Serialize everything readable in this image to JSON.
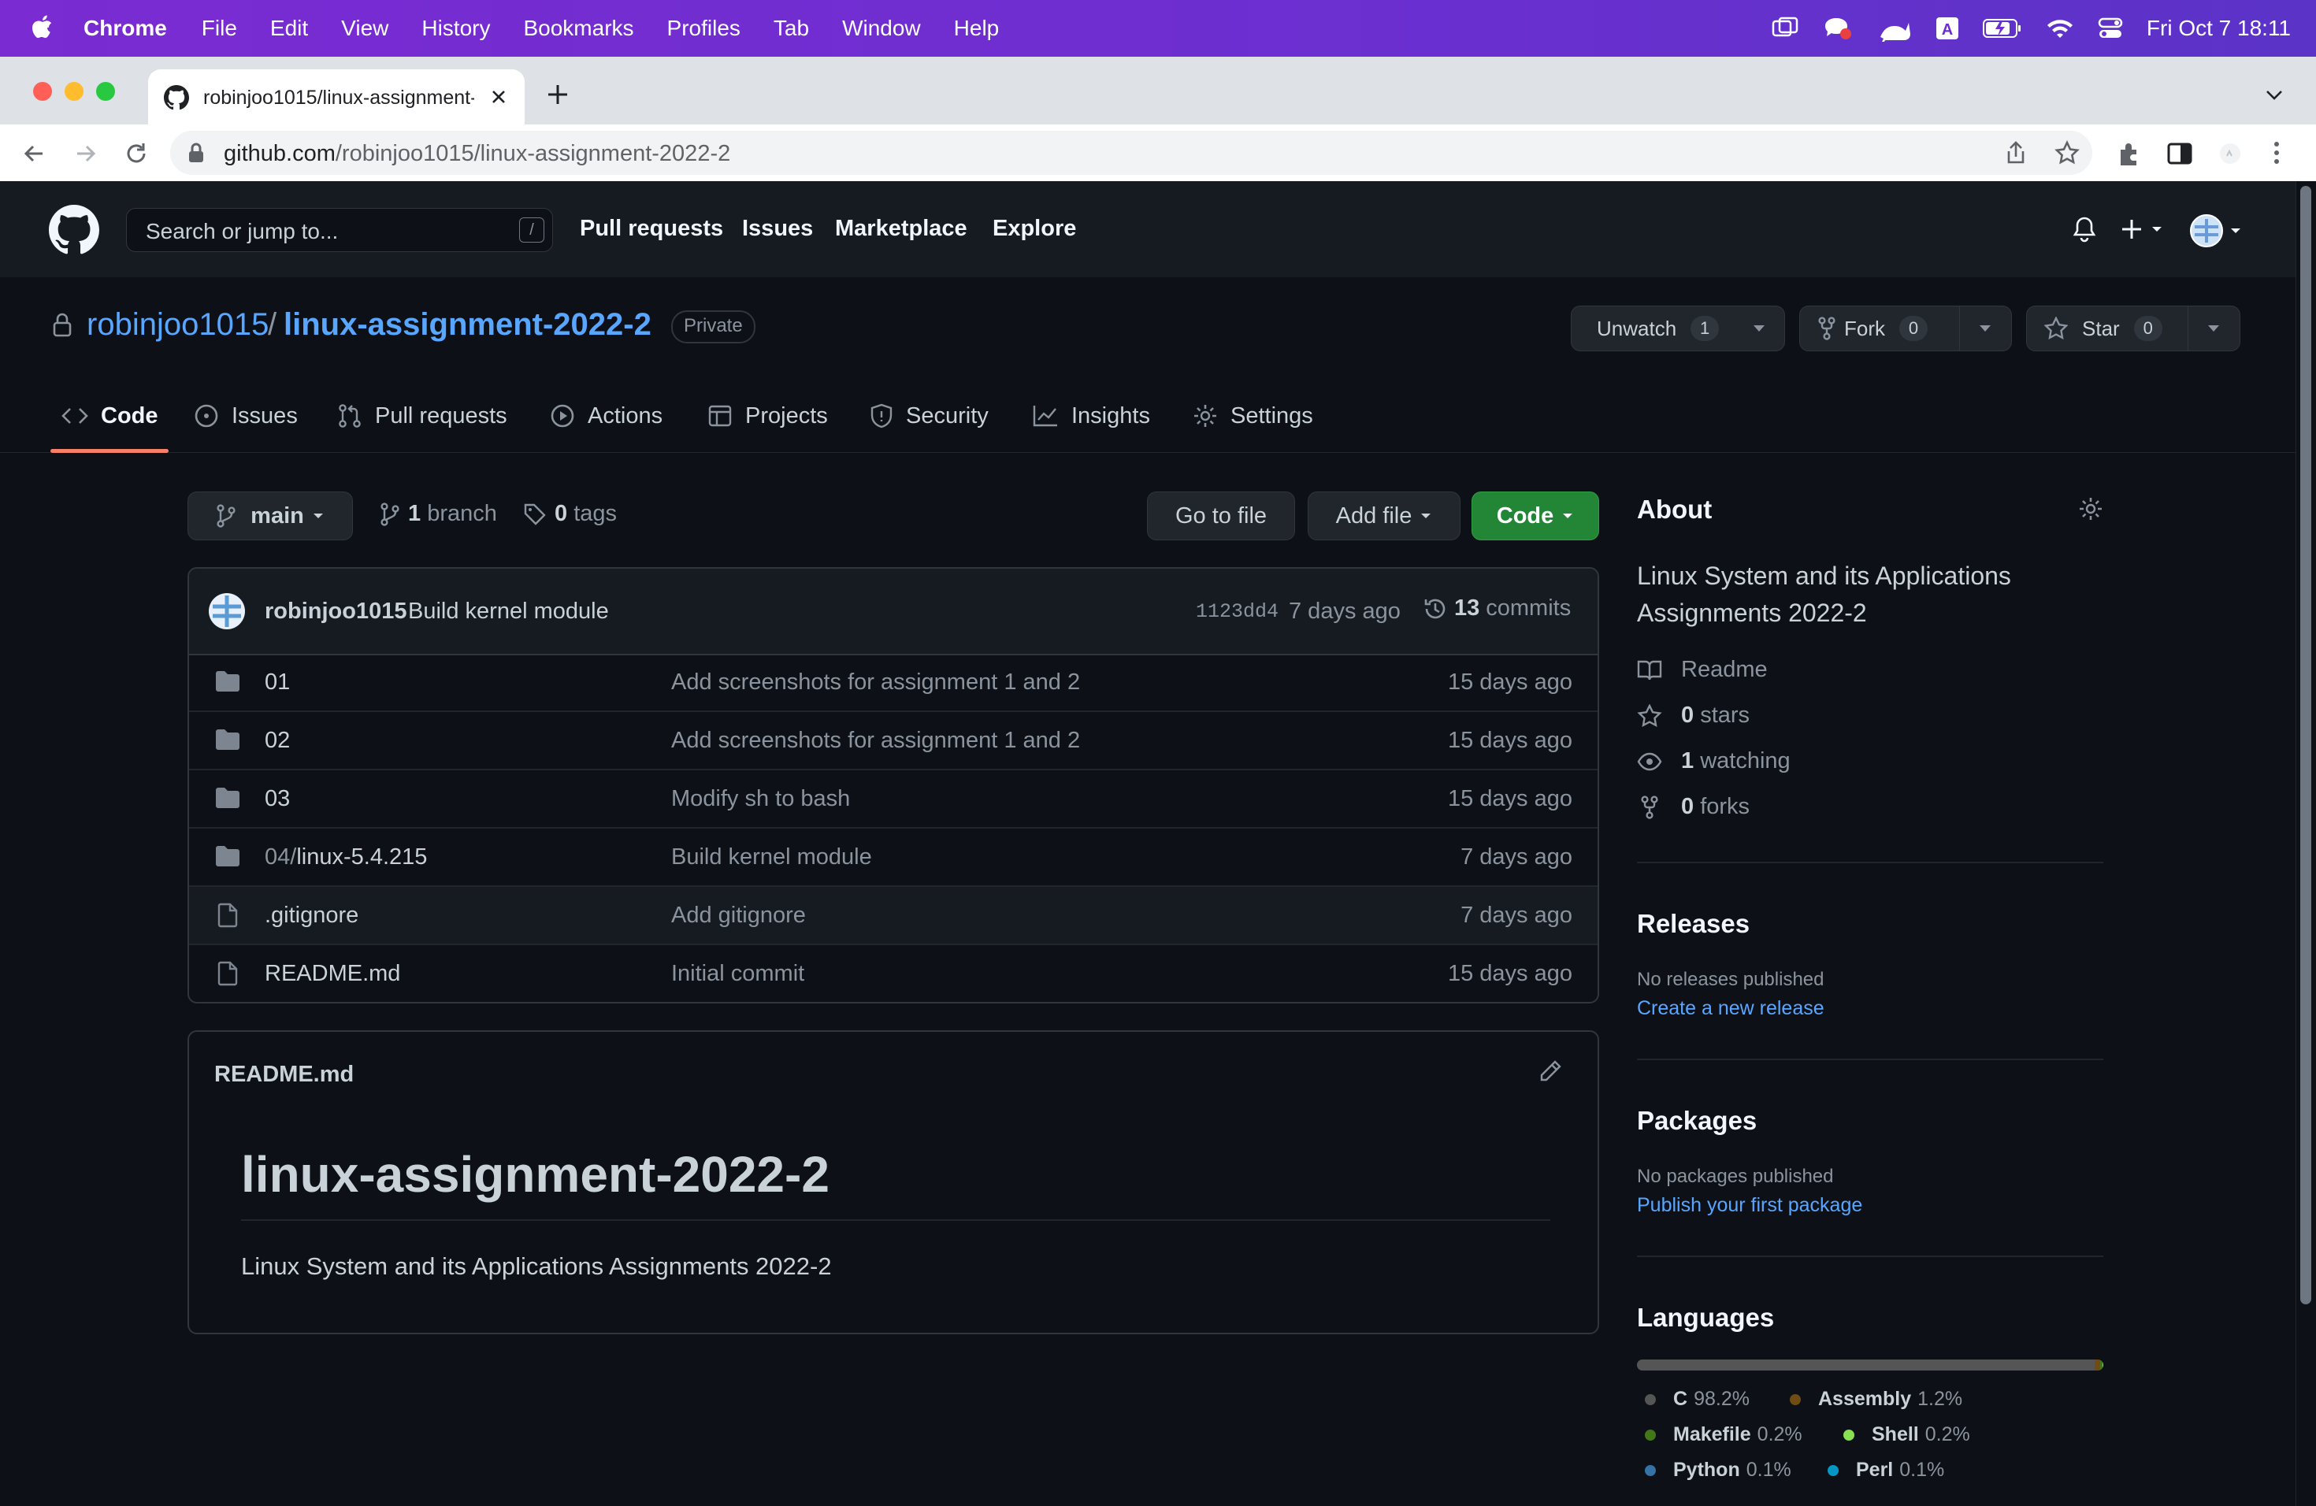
{
  "menubar": {
    "app_name": "Chrome",
    "menus": [
      "File",
      "Edit",
      "View",
      "History",
      "Bookmarks",
      "Profiles",
      "Tab",
      "Window",
      "Help"
    ],
    "clock": "Fri Oct 7  18:11"
  },
  "browser": {
    "tab_title": "robinjoo1015/linux-assignment-2022-2",
    "url_host": "github.com",
    "url_path": "/robinjoo1015/linux-assignment-2022-2"
  },
  "github": {
    "search_placeholder": "Search or jump to...",
    "search_shortcut": "/",
    "nav": [
      "Pull requests",
      "Issues",
      "Marketplace",
      "Explore"
    ]
  },
  "repo": {
    "owner": "robinjoo1015",
    "separator": "/",
    "name": "linux-assignment-2022-2",
    "visibility": "Private",
    "unwatch_label": "Unwatch",
    "watch_count": "1",
    "fork_label": "Fork",
    "fork_count": "0",
    "star_label": "Star",
    "star_count": "0",
    "tabs": [
      "Code",
      "Issues",
      "Pull requests",
      "Actions",
      "Projects",
      "Security",
      "Insights",
      "Settings"
    ]
  },
  "branchbar": {
    "branch": "main",
    "branch_count": "1",
    "branch_label": "branch",
    "tag_count": "0",
    "tag_label": "tags",
    "go_to_file": "Go to file",
    "add_file": "Add file",
    "code": "Code"
  },
  "latest_commit": {
    "author": "robinjoo1015",
    "message": "Build kernel module",
    "sha": "1123dd4",
    "age": "7 days ago",
    "commit_count": "13",
    "commit_label": "commits"
  },
  "files": [
    {
      "prefix": "",
      "name": "01",
      "type": "dir",
      "message": "Add screenshots for assignment 1 and 2",
      "age": "15 days ago"
    },
    {
      "prefix": "",
      "name": "02",
      "type": "dir",
      "message": "Add screenshots for assignment 1 and 2",
      "age": "15 days ago"
    },
    {
      "prefix": "",
      "name": "03",
      "type": "dir",
      "message": "Modify sh to bash",
      "age": "15 days ago"
    },
    {
      "prefix": "04/",
      "name": "linux-5.4.215",
      "type": "dir",
      "message": "Build kernel module",
      "age": "7 days ago"
    },
    {
      "prefix": "",
      "name": ".gitignore",
      "type": "file",
      "message": "Add gitignore",
      "age": "7 days ago"
    },
    {
      "prefix": "",
      "name": "README.md",
      "type": "file",
      "message": "Initial commit",
      "age": "15 days ago"
    }
  ],
  "readme": {
    "filename": "README.md",
    "heading": "linux-assignment-2022-2",
    "body": "Linux System and its Applications Assignments 2022-2"
  },
  "sidebar": {
    "about_title": "About",
    "description": "Linux System and its Applications Assignments 2022-2",
    "readme_label": "Readme",
    "stars_count": "0",
    "stars_label": "stars",
    "watching_count": "1",
    "watching_label": "watching",
    "forks_count": "0",
    "forks_label": "forks",
    "releases_title": "Releases",
    "releases_empty": "No releases published",
    "releases_link": "Create a new release",
    "packages_title": "Packages",
    "packages_empty": "No packages published",
    "packages_link": "Publish your first package",
    "languages_title": "Languages",
    "languages": [
      {
        "name": "C",
        "percent": "98.2%",
        "share": 98.2,
        "color": "#555555"
      },
      {
        "name": "Assembly",
        "percent": "1.2%",
        "share": 1.2,
        "color": "#6E4C13"
      },
      {
        "name": "Makefile",
        "percent": "0.2%",
        "share": 0.2,
        "color": "#427819"
      },
      {
        "name": "Shell",
        "percent": "0.2%",
        "share": 0.2,
        "color": "#89e051"
      },
      {
        "name": "Python",
        "percent": "0.1%",
        "share": 0.1,
        "color": "#3572A5"
      },
      {
        "name": "Perl",
        "percent": "0.1%",
        "share": 0.1,
        "color": "#0298c3"
      }
    ]
  },
  "colors": {
    "accent_link": "#58a6ff",
    "code_button": "#238636",
    "active_tab_underline": "#f78166",
    "menubar": "#6b2fd0"
  }
}
